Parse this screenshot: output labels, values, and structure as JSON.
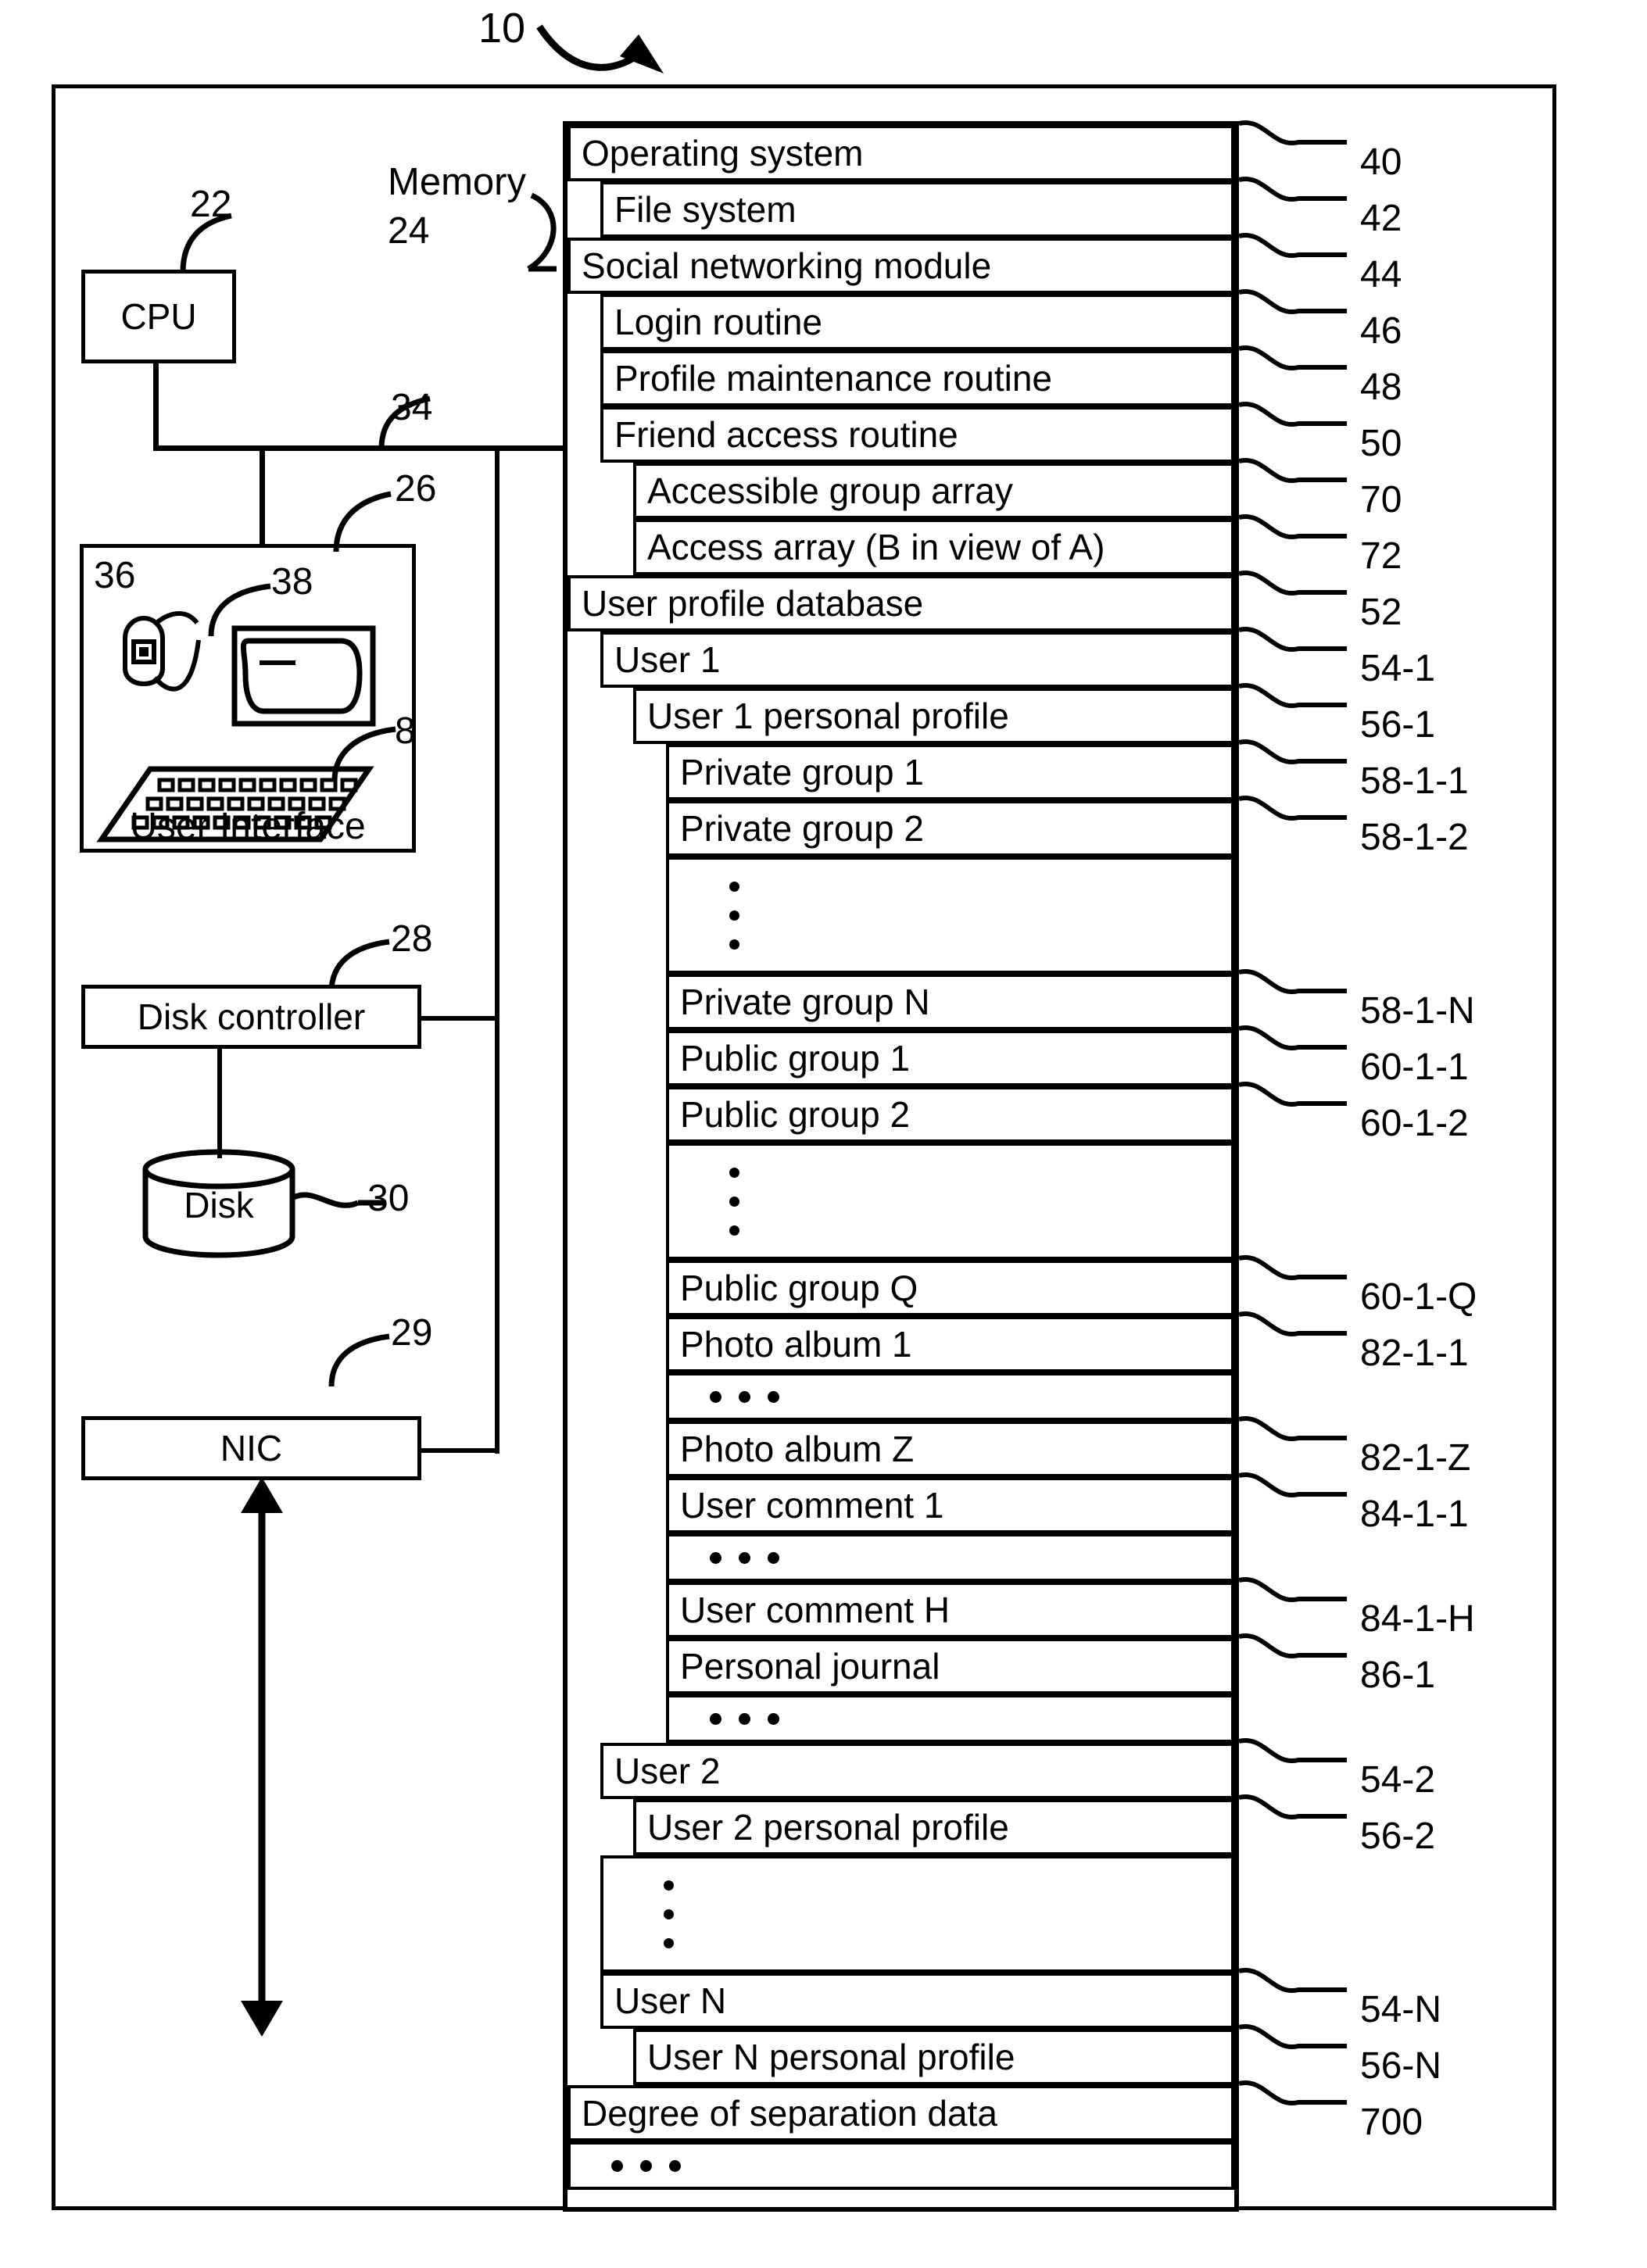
{
  "figure": {
    "system_ref": "10"
  },
  "left_column": {
    "cpu": {
      "label": "CPU",
      "ref": "22"
    },
    "memory": {
      "label": "Memory",
      "ref": "24"
    },
    "bus": {
      "ref": "34"
    },
    "user_interface": {
      "label": "User Interface",
      "ref": "26",
      "mouse_ref": "36",
      "monitor_ref": "38",
      "keyboard_ref": "8"
    },
    "disk_controller": {
      "label": "Disk controller",
      "ref": "28"
    },
    "disk": {
      "label": "Disk",
      "ref": "30"
    },
    "nic": {
      "label": "NIC",
      "ref": "29"
    }
  },
  "memory_contents": [
    {
      "label": "Operating system",
      "ref": "40",
      "indent": 0,
      "type": "text"
    },
    {
      "label": "File system",
      "ref": "42",
      "indent": 1,
      "type": "text"
    },
    {
      "label": "Social networking module",
      "ref": "44",
      "indent": 0,
      "type": "text"
    },
    {
      "label": "Login routine",
      "ref": "46",
      "indent": 1,
      "type": "text"
    },
    {
      "label": "Profile maintenance routine",
      "ref": "48",
      "indent": 1,
      "type": "text"
    },
    {
      "label": "Friend access routine",
      "ref": "50",
      "indent": 1,
      "type": "text"
    },
    {
      "label": "Accessible group array",
      "ref": "70",
      "indent": 2,
      "type": "text"
    },
    {
      "label": "Access array (B in view of A)",
      "ref": "72",
      "indent": 2,
      "type": "text"
    },
    {
      "label": "User profile database",
      "ref": "52",
      "indent": 0,
      "type": "text"
    },
    {
      "label": "User 1",
      "ref": "54-1",
      "indent": 1,
      "type": "text"
    },
    {
      "label": "User 1 personal profile",
      "ref": "56-1",
      "indent": 2,
      "type": "text"
    },
    {
      "label": "Private group 1",
      "ref": "58-1-1",
      "indent": 3,
      "type": "text"
    },
    {
      "label": "Private group 2",
      "ref": "58-1-2",
      "indent": 3,
      "type": "text"
    },
    {
      "label": "",
      "ref": "",
      "indent": 3,
      "type": "vdots"
    },
    {
      "label": "Private group N",
      "ref": "58-1-N",
      "indent": 3,
      "type": "text"
    },
    {
      "label": "Public group 1",
      "ref": "60-1-1",
      "indent": 3,
      "type": "text"
    },
    {
      "label": "Public group 2",
      "ref": "60-1-2",
      "indent": 3,
      "type": "text"
    },
    {
      "label": "",
      "ref": "",
      "indent": 3,
      "type": "vdots"
    },
    {
      "label": "Public group Q",
      "ref": "60-1-Q",
      "indent": 3,
      "type": "text"
    },
    {
      "label": "Photo album 1",
      "ref": "82-1-1",
      "indent": 3,
      "type": "text"
    },
    {
      "label": "",
      "ref": "",
      "indent": 3,
      "type": "hdots"
    },
    {
      "label": "Photo album Z",
      "ref": "82-1-Z",
      "indent": 3,
      "type": "text"
    },
    {
      "label": "User comment 1",
      "ref": "84-1-1",
      "indent": 3,
      "type": "text"
    },
    {
      "label": "",
      "ref": "",
      "indent": 3,
      "type": "hdots"
    },
    {
      "label": "User comment H",
      "ref": "84-1-H",
      "indent": 3,
      "type": "text"
    },
    {
      "label": "Personal journal",
      "ref": "86-1",
      "indent": 3,
      "type": "text"
    },
    {
      "label": "",
      "ref": "",
      "indent": 3,
      "type": "hdots"
    },
    {
      "label": "User 2",
      "ref": "54-2",
      "indent": 1,
      "type": "text"
    },
    {
      "label": "User 2 personal profile",
      "ref": "56-2",
      "indent": 2,
      "type": "text"
    },
    {
      "label": "",
      "ref": "",
      "indent": 1,
      "type": "vdots"
    },
    {
      "label": "User N",
      "ref": "54-N",
      "indent": 1,
      "type": "text"
    },
    {
      "label": "User N personal profile",
      "ref": "56-N",
      "indent": 2,
      "type": "text"
    },
    {
      "label": "Degree of separation data",
      "ref": "700",
      "indent": 0,
      "type": "text"
    },
    {
      "label": "",
      "ref": "",
      "indent": 0,
      "type": "hdots"
    }
  ]
}
